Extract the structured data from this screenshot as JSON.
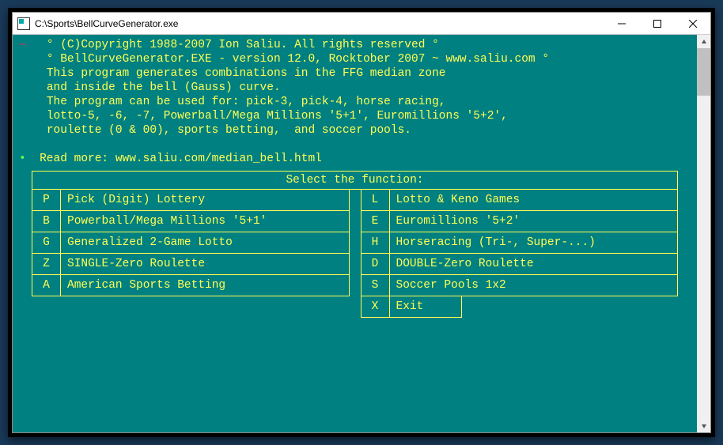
{
  "titlebar": {
    "path": "C:\\Sports\\BellCurveGenerator.exe"
  },
  "intro": {
    "cursor": "—",
    "line1": "° (C)Copyright 1988-2007 Ion Saliu. All rights reserved °",
    "line2": "° BellCurveGenerator.EXE - version 12.0, Rocktober 2007 ~ www.saliu.com °",
    "line3": "This program generates combinations in the FFG median zone",
    "line4": "and inside the bell (Gauss) curve.",
    "line5": "The program can be used for: pick-3, pick-4, horse racing,",
    "line6": "lotto-5, -6, -7, Powerball/Mega Millions '5+1', Euromillions '5+2',",
    "line7": "roulette (0 & 00), sports betting,  and soccer pools.",
    "bullet": "•",
    "readmore": "Read more: www.saliu.com/median_bell.html"
  },
  "menu": {
    "title": "Select the function:",
    "left": [
      {
        "key": "P",
        "label": "Pick (Digit) Lottery"
      },
      {
        "key": "B",
        "label": "Powerball/Mega Millions '5+1'"
      },
      {
        "key": "G",
        "label": "Generalized 2-Game Lotto"
      },
      {
        "key": "Z",
        "label": "SINGLE-Zero Roulette"
      },
      {
        "key": "A",
        "label": "American Sports Betting"
      }
    ],
    "right": [
      {
        "key": "L",
        "label": "Lotto & Keno Games"
      },
      {
        "key": "E",
        "label": "Euromillions '5+2'"
      },
      {
        "key": "H",
        "label": "Horseracing (Tri-, Super-...)"
      },
      {
        "key": "D",
        "label": "DOUBLE-Zero Roulette"
      },
      {
        "key": "S",
        "label": "Soccer Pools 1x2"
      }
    ],
    "exit": {
      "key": "X",
      "label": "Exit"
    }
  }
}
